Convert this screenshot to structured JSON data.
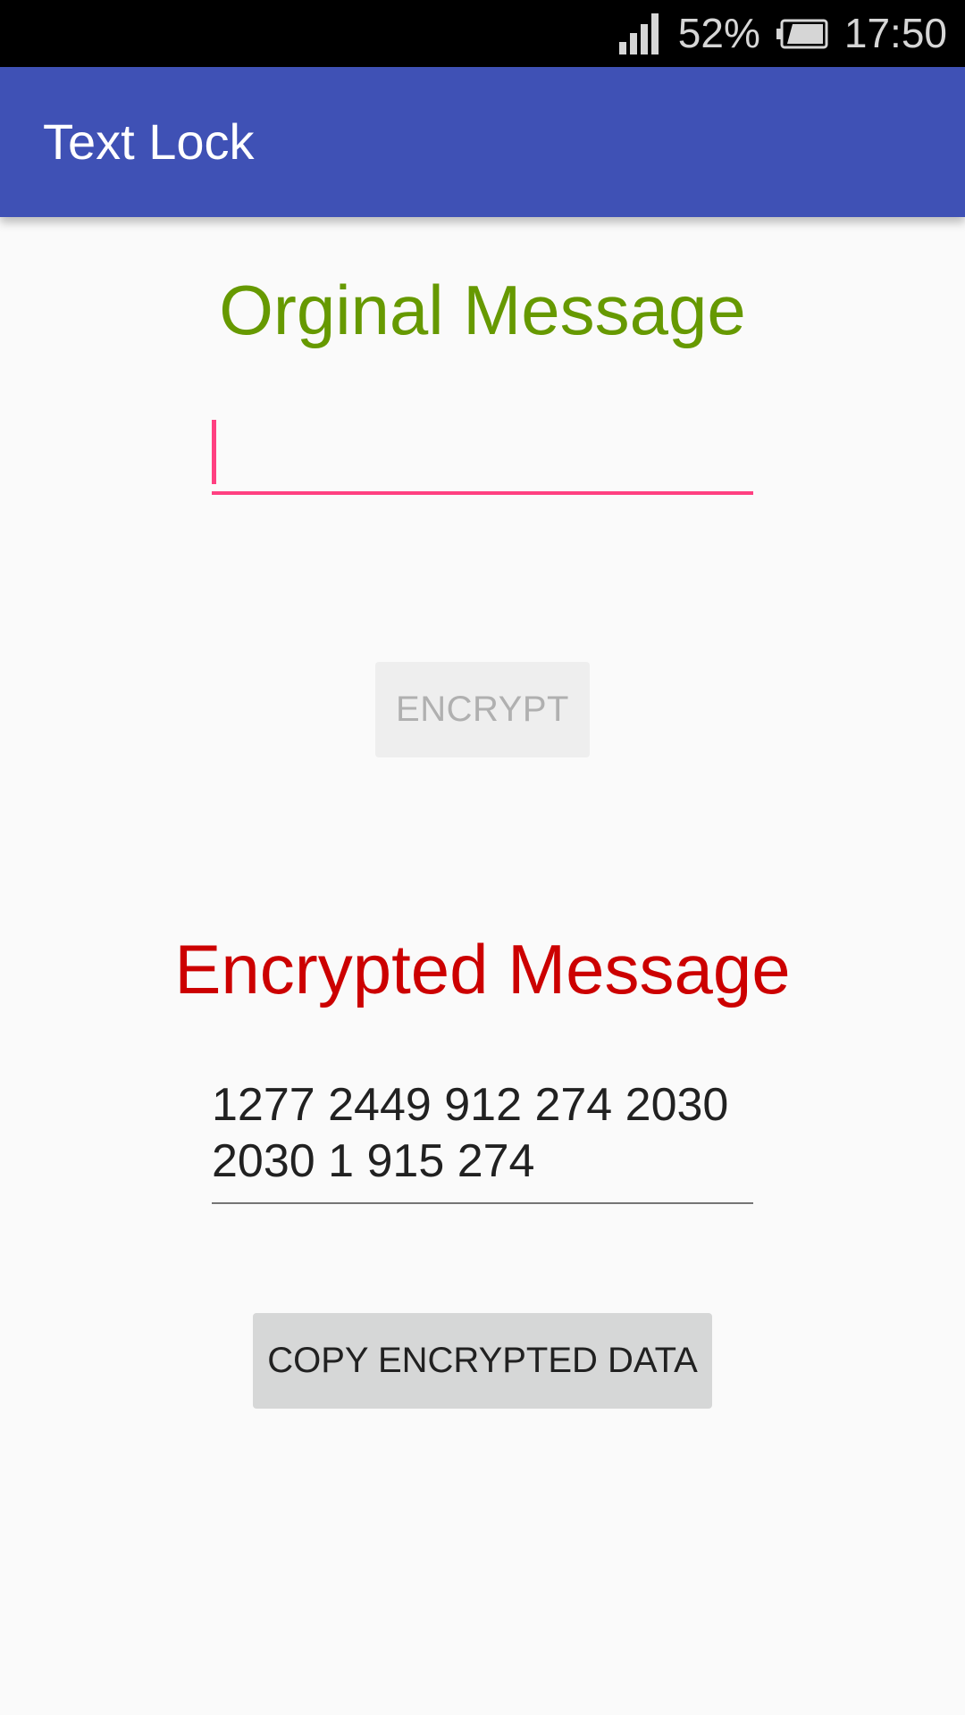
{
  "status_bar": {
    "battery_percent": "52%",
    "time": "17:50",
    "icons": [
      "signal-icon",
      "battery-icon"
    ]
  },
  "app_bar": {
    "title": "Text Lock",
    "color": "#3f51b5"
  },
  "original": {
    "heading": "Orginal Message",
    "heading_color": "#669900",
    "input_value": "",
    "input_accent": "#ff4081"
  },
  "encrypt_button": {
    "label": "ENCRYPT",
    "enabled": false,
    "text_color": "#b0b0b0",
    "background": "#eeeeee"
  },
  "encrypted": {
    "heading": "Encrypted Message",
    "heading_color": "#cc0000",
    "output": "1277 2449 912 274 2030 2030 1 915 274"
  },
  "copy_button": {
    "label": "COPY ENCRYPTED DATA",
    "text_color": "#212121",
    "background": "#d6d7d7"
  }
}
